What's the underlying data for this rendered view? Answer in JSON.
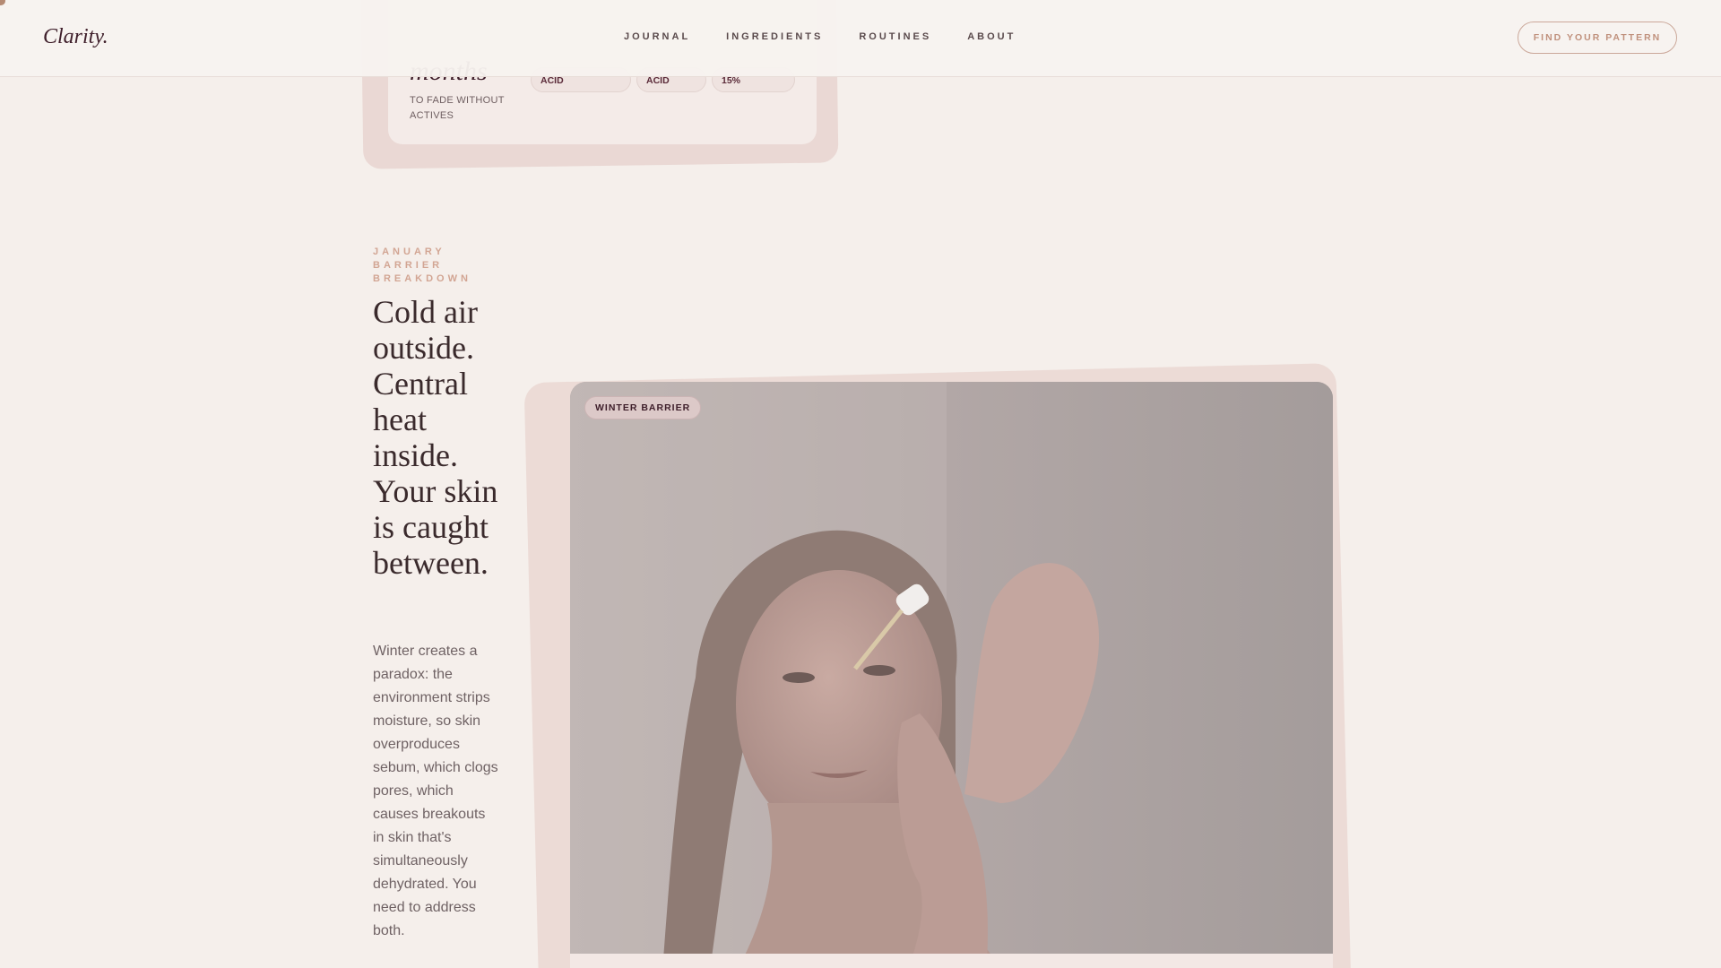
{
  "header": {
    "logo": "Clarity.",
    "nav": [
      "JOURNAL",
      "INGREDIENTS",
      "ROUTINES",
      "ABOUT"
    ],
    "cta_label": "FIND YOUR PATTERN"
  },
  "stat_card": {
    "value": "months",
    "caption": "TO FADE WITHOUT ACTIVES",
    "pills": [
      "ACID",
      "ACID",
      "15%"
    ]
  },
  "article": {
    "kicker": "JANUARY BARRIER BREAKDOWN",
    "headline": "Cold air outside. Central heat inside. Your skin is caught between.",
    "body": "Winter creates a paradox: the environment strips moisture, so skin overproduces sebum, which clogs pores, which causes breakouts in skin that's simultaneously dehydrated. You need to address both."
  },
  "photo": {
    "tag": "WINTER BARRIER"
  },
  "colors": {
    "background": "#f5efeb",
    "accent": "#c0917d",
    "brand": "#3e1e2a"
  }
}
